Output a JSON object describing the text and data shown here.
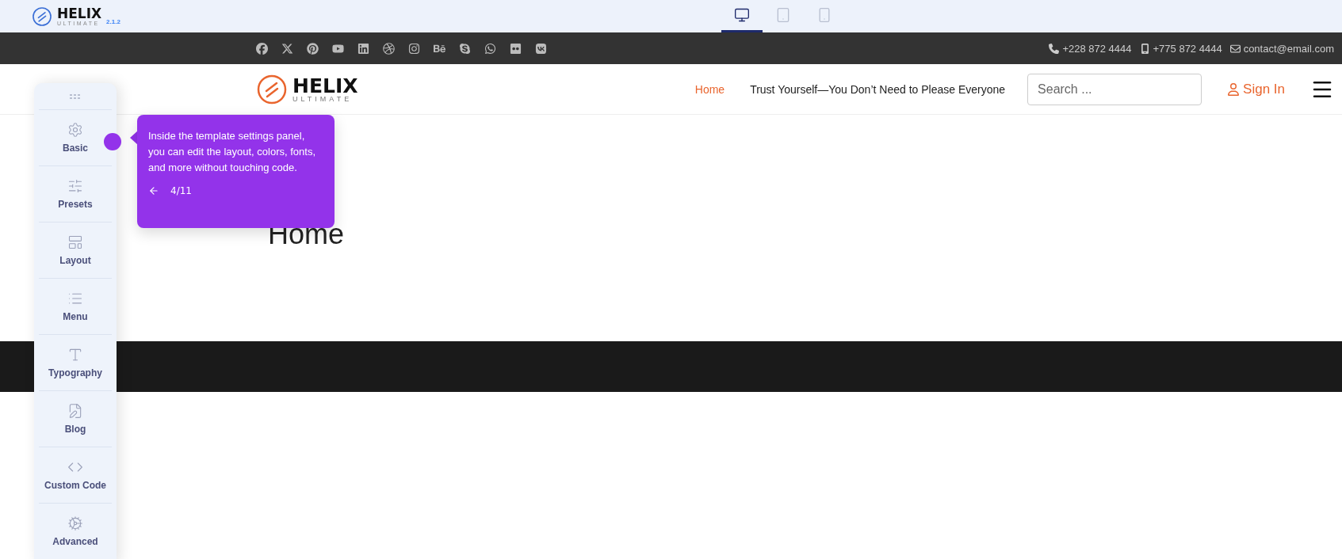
{
  "builder_bar": {
    "brand": "HELIX",
    "brand_sub": "ULTIMATE",
    "version": "2.1.2",
    "devices": [
      {
        "kind": "desktop",
        "selected": true
      },
      {
        "kind": "tablet",
        "selected": false
      },
      {
        "kind": "phone",
        "selected": false
      }
    ]
  },
  "top_bar": {
    "social_links": [
      {
        "kind": "facebook"
      },
      {
        "kind": "x"
      },
      {
        "kind": "pinterest"
      },
      {
        "kind": "youtube"
      },
      {
        "kind": "linkedin"
      },
      {
        "kind": "dribbble"
      },
      {
        "kind": "instagram"
      },
      {
        "kind": "behance"
      },
      {
        "kind": "skype"
      },
      {
        "kind": "whatsapp"
      },
      {
        "kind": "flickr"
      },
      {
        "kind": "vk"
      }
    ],
    "contacts": [
      {
        "kind": "phone",
        "text": "+228 872 4444"
      },
      {
        "kind": "mobile",
        "text": "+775 872 4444"
      },
      {
        "kind": "email",
        "text": "contact@email.com"
      }
    ]
  },
  "header": {
    "logo": {
      "title": "HELIX",
      "subtitle": "ULTIMATE"
    },
    "menu": [
      {
        "label": "Home",
        "selected": true
      },
      {
        "label": "Trust Yourself—You Don’t Need to Please Everyone",
        "selected": false
      }
    ],
    "search": {
      "placeholder": "Search ..."
    },
    "sign_in": "Sign In"
  },
  "page": {
    "heading": "Home"
  },
  "settings_panel": {
    "items": [
      {
        "kind": "basic",
        "label": "Basic"
      },
      {
        "kind": "presets",
        "label": "Presets"
      },
      {
        "kind": "layout",
        "label": "Layout"
      },
      {
        "kind": "menu",
        "label": "Menu"
      },
      {
        "kind": "typography",
        "label": "Typography"
      },
      {
        "kind": "blog",
        "label": "Blog"
      },
      {
        "kind": "code",
        "label": "Custom Code"
      },
      {
        "kind": "advanced",
        "label": "Advanced"
      }
    ]
  },
  "tour_tooltip": {
    "text": "Inside the template settings panel, you can edit the layout, colors, fonts, and more without touching code.",
    "step": "4/11"
  }
}
